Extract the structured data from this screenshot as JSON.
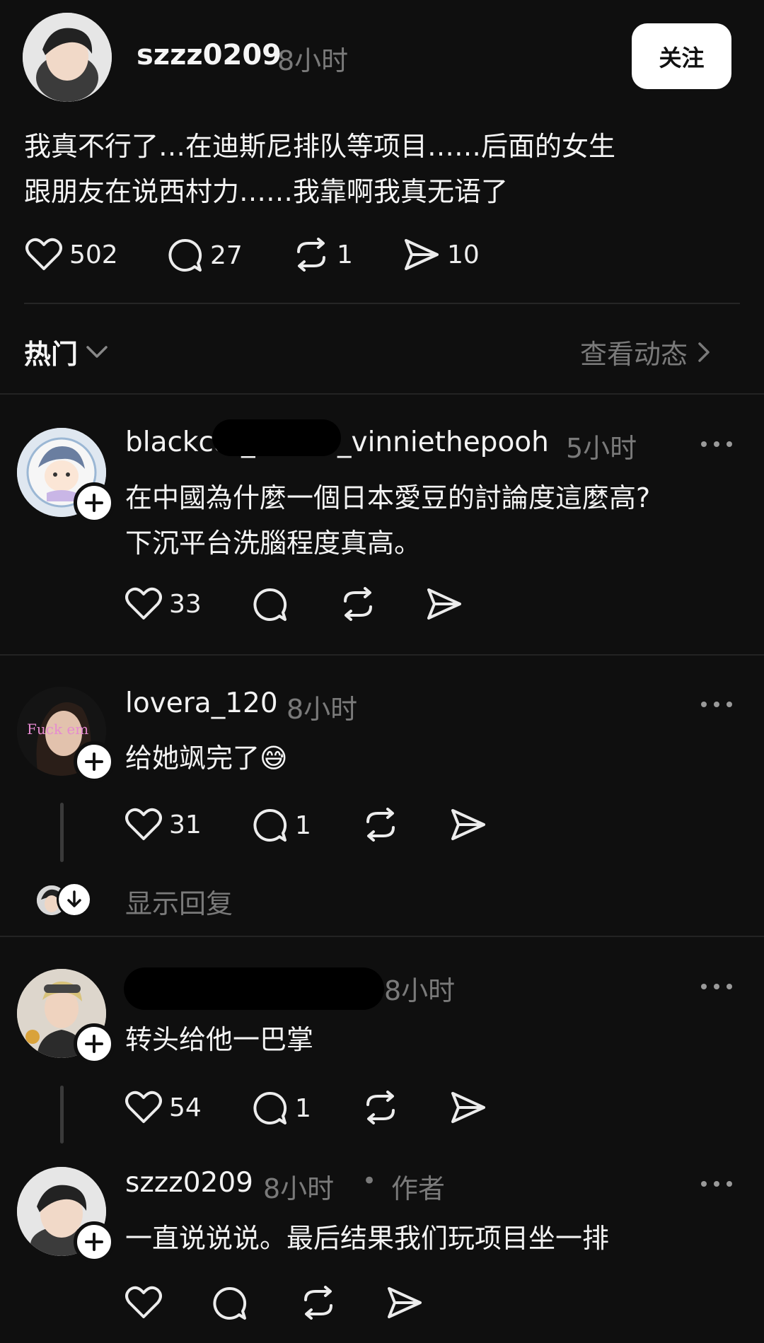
{
  "post": {
    "author": "szzz0209",
    "time": "8小时",
    "follow_label": "关注",
    "text_line1": "我真不行了…在迪斯尼排队等项目……后面的女生",
    "text_line2": "跟朋友在说西村力……我靠啊我真无语了",
    "likes": "502",
    "comments": "27",
    "reposts": "1",
    "shares": "10"
  },
  "sort": {
    "label": "热门",
    "view_activity": "查看动态"
  },
  "comments": [
    {
      "author_prefix": "blackcat_",
      "author_suffix": "_vinniethepooh",
      "time": "5小时",
      "text_line1": "在中國為什麼一個日本愛豆的討論度這麼高?",
      "text_line2": "下沉平台洗腦程度真高。",
      "likes": "33"
    },
    {
      "author": "lovera_120",
      "time": "8小时",
      "text": "给她飒完了😅",
      "avatar_text": "Fuck em",
      "likes": "31",
      "comments": "1",
      "show_replies": "显示回复"
    },
    {
      "time": "8小时",
      "text": "转头给他一巴掌",
      "likes": "54",
      "comments": "1"
    },
    {
      "author": "szzz0209",
      "time": "8小时",
      "dot": "•",
      "role": "作者",
      "text": "一直说说说。最后结果我们玩项目坐一排"
    }
  ],
  "colors": {
    "background": "#0f0f0f",
    "text": "#f3f3f3",
    "secondary": "#7a7a7a",
    "follow_button_bg": "#ffffff"
  }
}
